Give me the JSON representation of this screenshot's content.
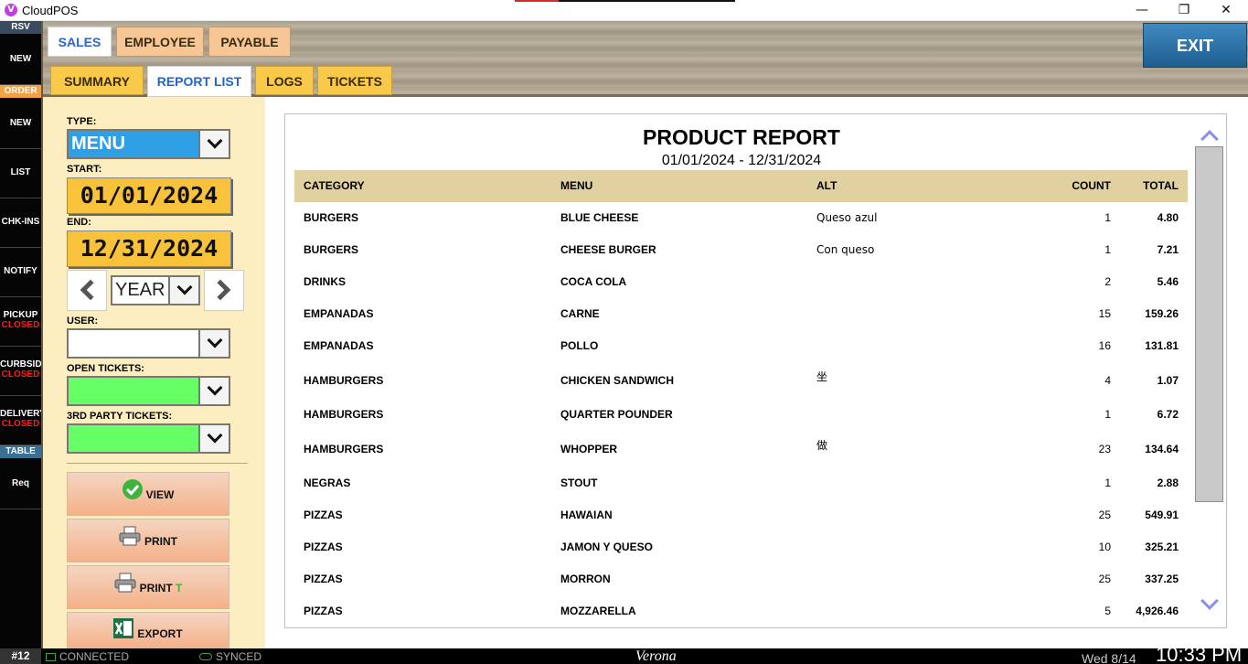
{
  "window": {
    "title": "CloudPOS",
    "logo_letter": "V",
    "min_glyph": "—",
    "max_glyph": "❐",
    "close_glyph": "✕"
  },
  "sidebar": {
    "rsv_header": "RSV",
    "order_header": "ORDER",
    "table_header": "TABLE",
    "items": [
      {
        "label": "NEW",
        "sub": ""
      },
      {
        "label": "NEW",
        "sub": ""
      },
      {
        "label": "LIST",
        "sub": ""
      },
      {
        "label": "CHK-INS",
        "sub": ""
      },
      {
        "label": "NOTIFY",
        "sub": ""
      },
      {
        "label": "PICKUP",
        "sub": "CLOSED"
      },
      {
        "label": "CURBSID",
        "sub": "CLOSED"
      },
      {
        "label": "DELIVERY",
        "sub": "CLOSED"
      },
      {
        "label": "Req",
        "sub": ""
      }
    ]
  },
  "tabs": {
    "sales": "SALES",
    "employee": "EMPLOYEE",
    "payable": "PAYABLE"
  },
  "subtabs": {
    "summary": "SUMMARY",
    "report_list": "REPORT LIST",
    "logs": "LOGS",
    "tickets": "TICKETS"
  },
  "exit_label": "EXIT",
  "filters": {
    "type_label": "TYPE:",
    "type_value": "MENU",
    "start_label": "START:",
    "start_value": "01/01/2024",
    "end_label": "END:",
    "end_value": "12/31/2024",
    "period_value": "YEAR",
    "user_label": "USER:",
    "user_value": "",
    "open_tickets_label": "OPEN TICKETS:",
    "open_tickets_value": "",
    "third_party_label": "3RD PARTY TICKETS:",
    "third_party_value": ""
  },
  "actions": {
    "view": "VIEW",
    "print": "PRINT",
    "print_t": "PRINT",
    "print_t_suffix": "T",
    "export": "EXPORT"
  },
  "report": {
    "title": "PRODUCT REPORT",
    "date_range": "01/01/2024 - 12/31/2024",
    "columns": {
      "category": "CATEGORY",
      "menu": "MENU",
      "alt": "ALT",
      "count": "COUNT",
      "total": "TOTAL"
    },
    "rows": [
      {
        "category": "BURGERS",
        "menu": "BLUE CHEESE",
        "alt": "Queso azul",
        "count": "1",
        "total": "4.80"
      },
      {
        "category": "BURGERS",
        "menu": "CHEESE BURGER",
        "alt": "Con queso",
        "count": "1",
        "total": "7.21"
      },
      {
        "category": "DRINKS",
        "menu": "COCA COLA",
        "alt": "",
        "count": "2",
        "total": "5.46"
      },
      {
        "category": "EMPANADAS",
        "menu": "CARNE",
        "alt": "",
        "count": "15",
        "total": "159.26"
      },
      {
        "category": "EMPANADAS",
        "menu": "POLLO",
        "alt": "",
        "count": "16",
        "total": "131.81"
      },
      {
        "category": "HAMBURGERS",
        "menu": "CHICKEN SANDWICH",
        "alt": "坐",
        "count": "4",
        "total": "1.07"
      },
      {
        "category": "HAMBURGERS",
        "menu": "QUARTER POUNDER",
        "alt": "",
        "count": "1",
        "total": "6.72"
      },
      {
        "category": "HAMBURGERS",
        "menu": "WHOPPER",
        "alt": "做",
        "count": "23",
        "total": "134.64"
      },
      {
        "category": "NEGRAS",
        "menu": "STOUT",
        "alt": "",
        "count": "1",
        "total": "2.88"
      },
      {
        "category": "PIZZAS",
        "menu": "HAWAIAN",
        "alt": "",
        "count": "25",
        "total": "549.91"
      },
      {
        "category": "PIZZAS",
        "menu": "JAMON Y QUESO",
        "alt": "",
        "count": "10",
        "total": "325.21"
      },
      {
        "category": "PIZZAS",
        "menu": "MORRON",
        "alt": "",
        "count": "25",
        "total": "337.25"
      },
      {
        "category": "PIZZAS",
        "menu": "MOZZARELLA",
        "alt": "",
        "count": "5",
        "total": "4,926.46"
      }
    ]
  },
  "statusbar": {
    "station": "#12",
    "connection": "CONNECTED",
    "sync": "SYNCED",
    "location": "Verona",
    "date": "Wed 8/14",
    "time": "10:33 PM"
  },
  "colors": {
    "accent_blue": "#2b63d2",
    "tab_orange": "#f6c794",
    "tab_yellow": "#f9c94a",
    "date_yellow": "#f8c23a",
    "green_select": "#66ff66",
    "menu_select_blue": "#2f9fe6",
    "closed_red": "#ff1a1a"
  }
}
